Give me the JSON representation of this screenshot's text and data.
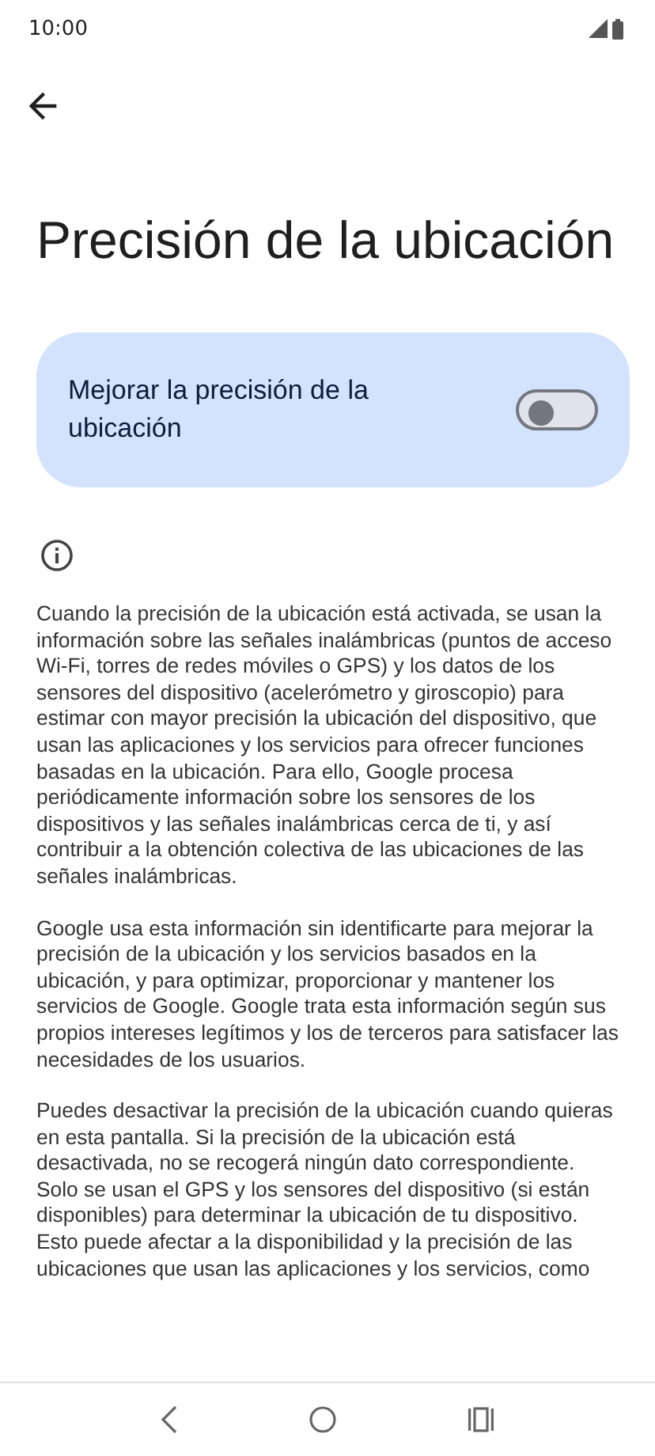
{
  "status_bar": {
    "time": "10:00"
  },
  "title": "Precisión de la ubicación",
  "setting": {
    "label": "Mejorar la precisión de la ubicación",
    "on": false
  },
  "paragraphs": [
    "Cuando la precisión de la ubicación está activada, se usan la información sobre las señales inalámbricas (puntos de acceso Wi-Fi, torres de redes móviles o GPS) y los datos de los sensores del dispositivo (acelerómetro y giroscopio) para estimar con mayor precisión la ubicación del dispositivo, que usan las aplicaciones y los servicios para ofrecer funciones basadas en la ubicación. Para ello, Google procesa periódicamente información sobre los sensores de los dispositivos y las señales inalámbricas cerca de ti, y así contribuir a la obtención colectiva de las ubicaciones de las señales inalámbricas.",
    "Google usa esta información sin identificarte para mejorar la precisión de la ubicación y los servicios basados en la ubicación, y para optimizar, proporcionar y mantener los servicios de Google. Google trata esta información según sus propios intereses legítimos y los de terceros para satisfacer las necesidades de los usuarios.",
    "Puedes desactivar la precisión de la ubicación cuando quieras en esta pantalla. Si la precisión de la ubicación está desactivada, no se recogerá ningún dato correspondiente. Solo se usan el GPS y los sensores del dispositivo (si están disponibles) para determinar la ubicación de tu dispositivo. Esto puede afectar a la disponibilidad y la precisión de las ubicaciones que usan las aplicaciones y los servicios, como"
  ]
}
